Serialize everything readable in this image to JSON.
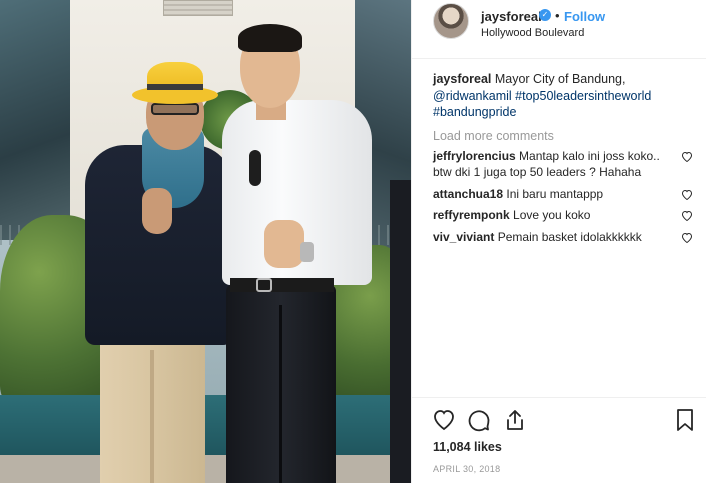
{
  "post": {
    "username": "jaysforeal",
    "verified_badge": "verified-icon",
    "separator": "•",
    "follow_label": "Follow",
    "location": "Hollywood Boulevard"
  },
  "caption": {
    "username": "jaysforeal",
    "text": "Mayor City of Bandung,",
    "mention": "@ridwankamil",
    "hashtag1": "#top50leadersintheworld",
    "hashtag2": "#bandungpride"
  },
  "load_more_label": "Load more comments",
  "comments": [
    {
      "user": "jeffrylorencius",
      "text": "Mantap kalo ini joss koko.. btw dki 1 juga top 50 leaders ? Hahaha"
    },
    {
      "user": "attanchua18",
      "text": "Ini baru mantappp"
    },
    {
      "user": "reffyremponk",
      "text": "Love you koko"
    },
    {
      "user": "viv_viviant",
      "text": "Pemain basket idolakkkkkk"
    }
  ],
  "actions": {
    "like_icon": "heart-icon",
    "comment_icon": "comment-icon",
    "share_icon": "share-icon",
    "save_icon": "bookmark-icon"
  },
  "likes_label": "11,084 likes",
  "date_label": "APRIL 30, 2018",
  "colors": {
    "link": "#003569",
    "follow": "#3897f0",
    "muted": "#999999",
    "text": "#262626"
  }
}
